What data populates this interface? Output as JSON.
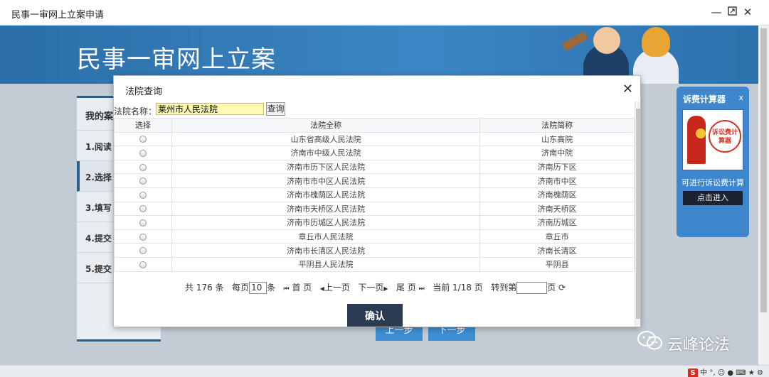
{
  "window": {
    "title": "民事一审网上立案申请",
    "minimize_icon": "minimize-icon",
    "maximize_icon": "maximize-icon",
    "close_icon": "close-icon"
  },
  "banner": {
    "title": "民事一审网上立案"
  },
  "left_nav": {
    "header": "我的案",
    "items": [
      "1.阅读",
      "2.选择",
      "3.填写",
      "4.提交",
      "5.提交"
    ]
  },
  "bottom_buttons": {
    "prev": "上一步",
    "next": "下一步"
  },
  "fee_widget": {
    "title": "诉费计算器",
    "close": "x",
    "image_text": "诉讼费计算器",
    "description": "可进行诉讼费计算",
    "enter_button": "点击进入"
  },
  "modal": {
    "title": "法院查询",
    "search_label": "法院名称：",
    "search_value": "莱州市人民法院",
    "search_button": "查询",
    "columns": [
      "选择",
      "法院全称",
      "法院简称"
    ],
    "rows": [
      {
        "full": "山东省高级人民法院",
        "short": "山东高院"
      },
      {
        "full": "济南市中级人民法院",
        "short": "济南中院"
      },
      {
        "full": "济南市历下区人民法院",
        "short": "济南历下区"
      },
      {
        "full": "济南市市中区人民法院",
        "short": "济南市中区"
      },
      {
        "full": "济南市槐荫区人民法院",
        "short": "济南槐荫区"
      },
      {
        "full": "济南市天桥区人民法院",
        "short": "济南天桥区"
      },
      {
        "full": "济南市历城区人民法院",
        "short": "济南历城区"
      },
      {
        "full": "章丘市人民法院",
        "short": "章丘市"
      },
      {
        "full": "济南市长清区人民法院",
        "short": "济南长清区"
      },
      {
        "full": "平阴县人民法院",
        "short": "平阴县"
      }
    ],
    "pager": {
      "total_prefix": "共",
      "total": "176",
      "total_suffix": "条",
      "page_size_prefix": "每页",
      "page_size": "10",
      "page_size_suffix": "条",
      "first": "首 页",
      "prev": "上一页",
      "next": "下一页",
      "last": "尾 页",
      "current": "当前 1/18 页",
      "jump_prefix": "转到第",
      "jump_suffix": "页"
    },
    "confirm_button": "确认"
  },
  "watermark": {
    "text": "云峰论法"
  },
  "colors": {
    "banner_blue": "#3b86c4",
    "confirm_dark": "#2a3b52",
    "search_highlight": "#fffbb6",
    "fee_blue": "#3f87cd"
  }
}
